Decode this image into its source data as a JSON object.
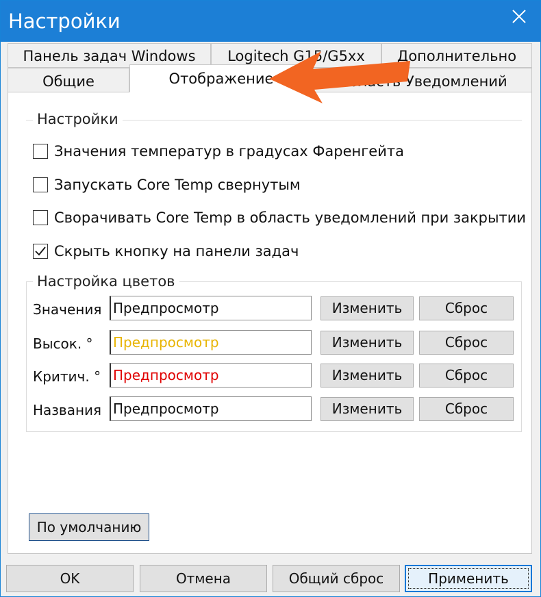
{
  "window": {
    "title": "Настройки"
  },
  "tabs": {
    "row1": [
      "Панель задач Windows",
      "Logitech G15/G5xx",
      "Дополнительно"
    ],
    "row2": [
      "Общие",
      "Отображение",
      "Область Уведомлений"
    ],
    "active": "Отображение"
  },
  "settings_group": {
    "legend": "Настройки",
    "checkboxes": [
      {
        "label": "Значения температур в градусах Фаренгейта",
        "checked": false
      },
      {
        "label": "Запускать Core Temp свернутым",
        "checked": false
      },
      {
        "label": "Сворачивать Core Temp в область уведомлений при закрытии",
        "checked": false
      },
      {
        "label": "Скрыть кнопку на панели задач",
        "checked": true
      }
    ]
  },
  "colors_group": {
    "legend": "Настройка цветов",
    "rows": [
      {
        "label": "Значения",
        "preview": "Предпросмотр",
        "preview_color": "#111111",
        "change": "Изменить",
        "reset": "Сброс"
      },
      {
        "label": "Высок. °",
        "preview": "Предпросмотр",
        "preview_color": "#e8b400",
        "change": "Изменить",
        "reset": "Сброс"
      },
      {
        "label": "Критич. °",
        "preview": "Предпросмотр",
        "preview_color": "#e00000",
        "change": "Изменить",
        "reset": "Сброс"
      },
      {
        "label": "Названия",
        "preview": "Предпросмотр",
        "preview_color": "#111111",
        "change": "Изменить",
        "reset": "Сброс"
      }
    ]
  },
  "defaults_button": "По умолчанию",
  "footer": {
    "ok": "OK",
    "cancel": "Отмена",
    "reset_all": "Общий сброс",
    "apply": "Применить"
  },
  "colors": {
    "titlebar": "#1c7fd6",
    "annotation_arrow": "#f26522",
    "accent": "#0078d7"
  }
}
